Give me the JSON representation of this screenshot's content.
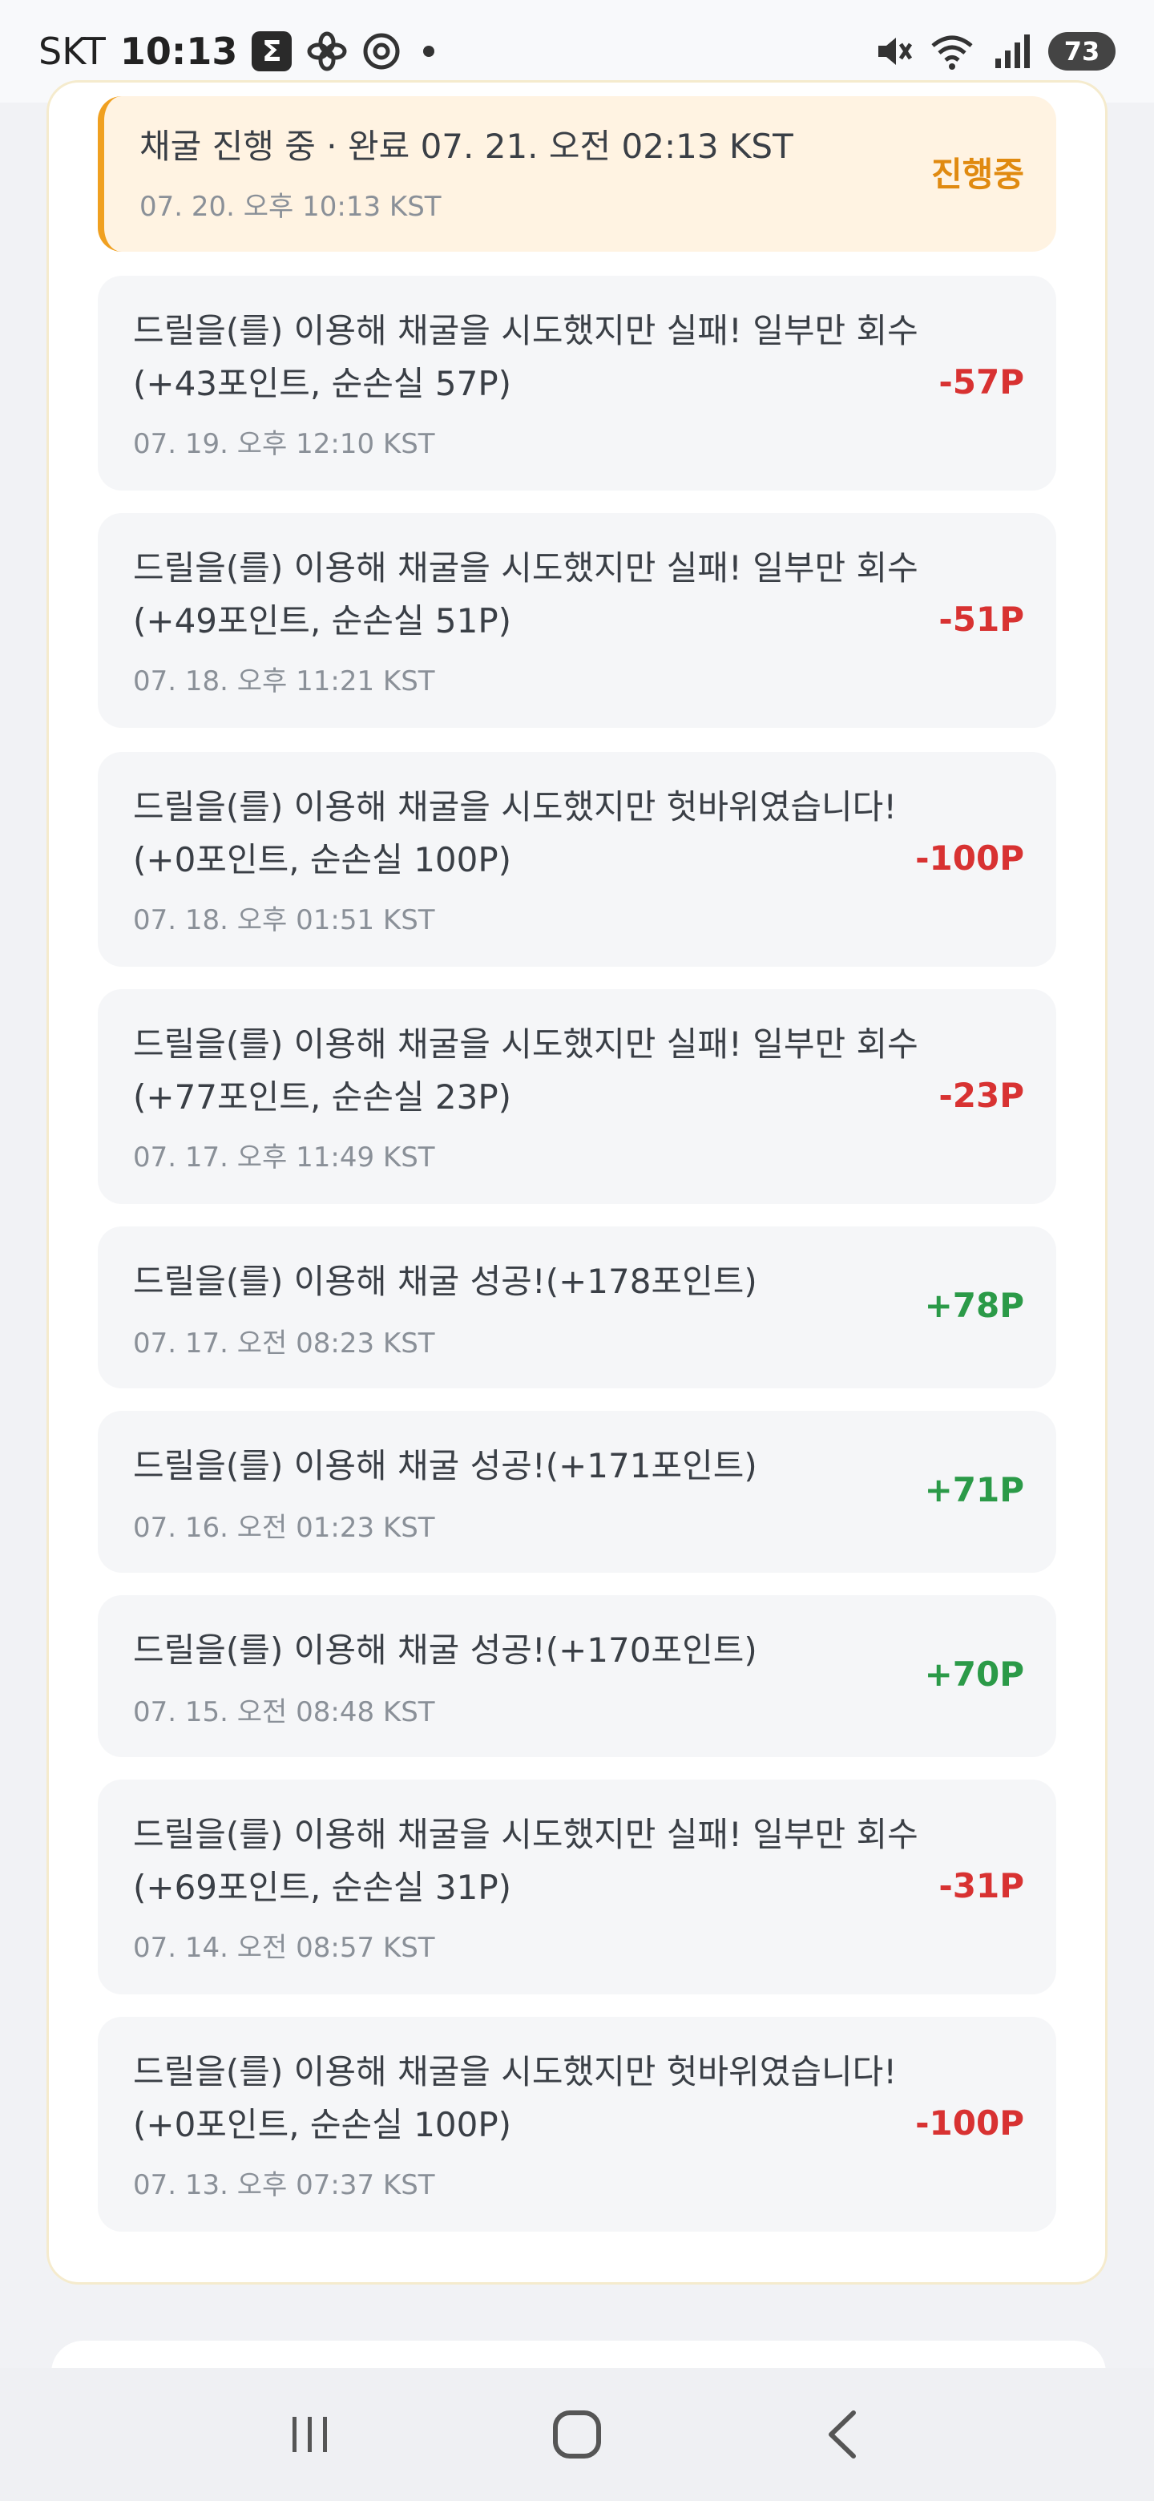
{
  "status_bar": {
    "carrier": "SKT",
    "time": "10:13",
    "app_badge": "Σ",
    "battery": "73",
    "icons": [
      "sigma-app-icon",
      "pinwheel-icon",
      "chrome-icon",
      "notification-dot-icon",
      "mute-icon",
      "wifi-icon",
      "signal-icon",
      "battery-icon"
    ]
  },
  "entries": [
    {
      "title": "채굴 진행 중 · 완료 07. 21. 오전 02:13 KST",
      "date": "07. 20. 오후 10:13 KST",
      "amount": "진행중",
      "kind": "progress"
    },
    {
      "title": "드릴을(를) 이용해 채굴을 시도했지만 실패! 일부만 회수(+43포인트, 순손실 57P)",
      "date": "07. 19. 오후 12:10 KST",
      "amount": "-57P",
      "kind": "neg"
    },
    {
      "title": "드릴을(를) 이용해 채굴을 시도했지만 실패! 일부만 회수(+49포인트, 순손실 51P)",
      "date": "07. 18. 오후 11:21 KST",
      "amount": "-51P",
      "kind": "neg"
    },
    {
      "title": "드릴을(를) 이용해 채굴을 시도했지만 헛바위였습니다!(+0포인트, 순손실 100P)",
      "date": "07. 18. 오후 01:51 KST",
      "amount": "-100P",
      "kind": "neg"
    },
    {
      "title": "드릴을(를) 이용해 채굴을 시도했지만 실패! 일부만 회수(+77포인트, 순손실 23P)",
      "date": "07. 17. 오후 11:49 KST",
      "amount": "-23P",
      "kind": "neg"
    },
    {
      "title": "드릴을(를) 이용해 채굴 성공!(+178포인트)",
      "date": "07. 17. 오전 08:23 KST",
      "amount": "+78P",
      "kind": "pos"
    },
    {
      "title": "드릴을(를) 이용해 채굴 성공!(+171포인트)",
      "date": "07. 16. 오전 01:23 KST",
      "amount": "+71P",
      "kind": "pos"
    },
    {
      "title": "드릴을(를) 이용해 채굴 성공!(+170포인트)",
      "date": "07. 15. 오전 08:48 KST",
      "amount": "+70P",
      "kind": "pos"
    },
    {
      "title": "드릴을(를) 이용해 채굴을 시도했지만 실패! 일부만 회수(+69포인트, 순손실 31P)",
      "date": "07. 14. 오전 08:57 KST",
      "amount": "-31P",
      "kind": "neg"
    },
    {
      "title": "드릴을(를) 이용해 채굴을 시도했지만 헛바위였습니다!(+0포인트, 순손실 100P)",
      "date": "07. 13. 오후 07:37 KST",
      "amount": "-100P",
      "kind": "neg"
    }
  ],
  "nav": {
    "icons": [
      "recent-apps-icon",
      "home-icon",
      "back-icon"
    ]
  },
  "colors": {
    "negative": "#d83232",
    "positive": "#2b9a48",
    "in_progress": "#e08a10",
    "progress_bg": "#fff3e2"
  }
}
